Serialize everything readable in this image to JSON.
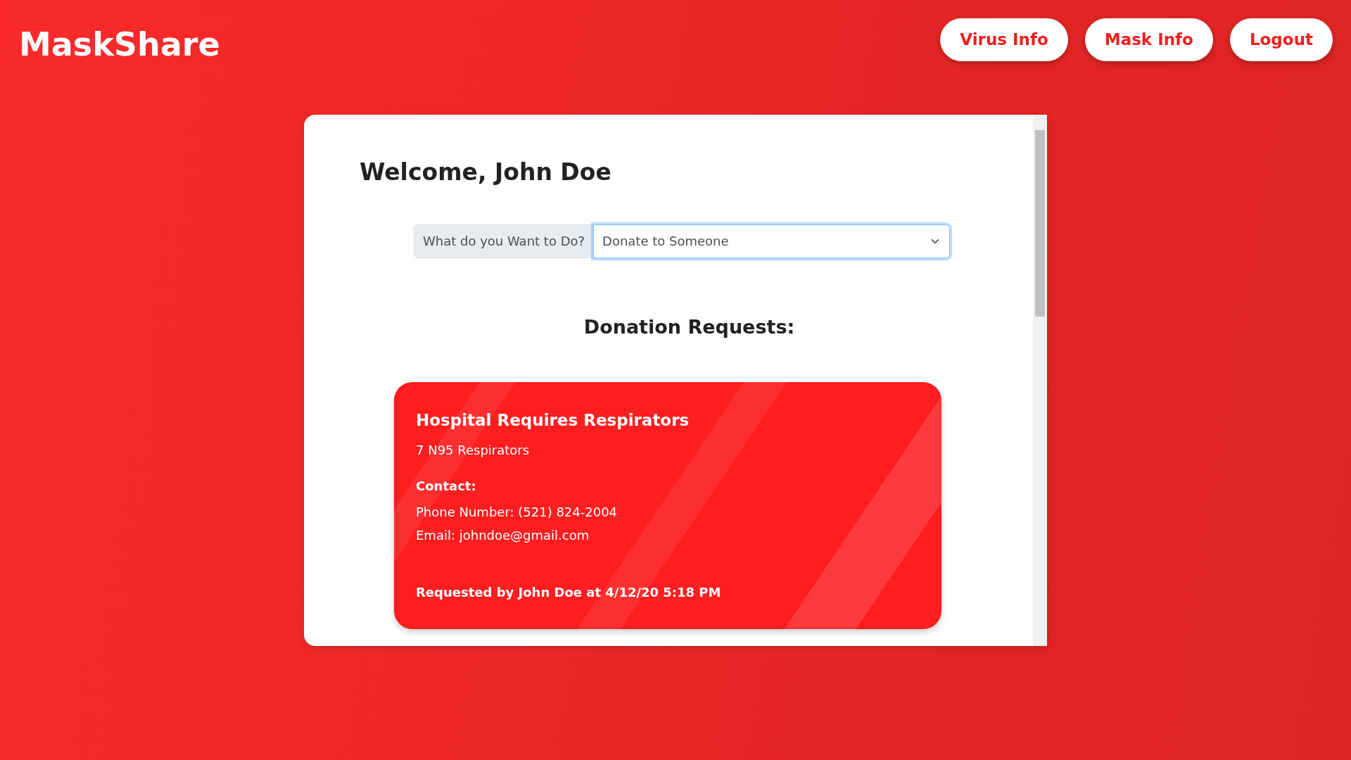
{
  "brand": "MaskShare",
  "nav_buttons": [
    "Virus Info",
    "Mask Info",
    "Logout"
  ],
  "welcome": "Welcome, John Doe",
  "action_select": {
    "label": "What do you Want to Do?",
    "value": "Donate to Someone",
    "focused": true
  },
  "section_title": "Donation Requests:",
  "requests": [
    {
      "title": "Hospital Requires Respirators",
      "item": "7 N95 Respirators",
      "contact_label": "Contact:",
      "phone": "Phone Number: (521) 824-2004",
      "email": "Email: johndoe@gmail.com",
      "footer": "Requested by John Doe at 4/12/20 5:18 PM"
    }
  ]
}
